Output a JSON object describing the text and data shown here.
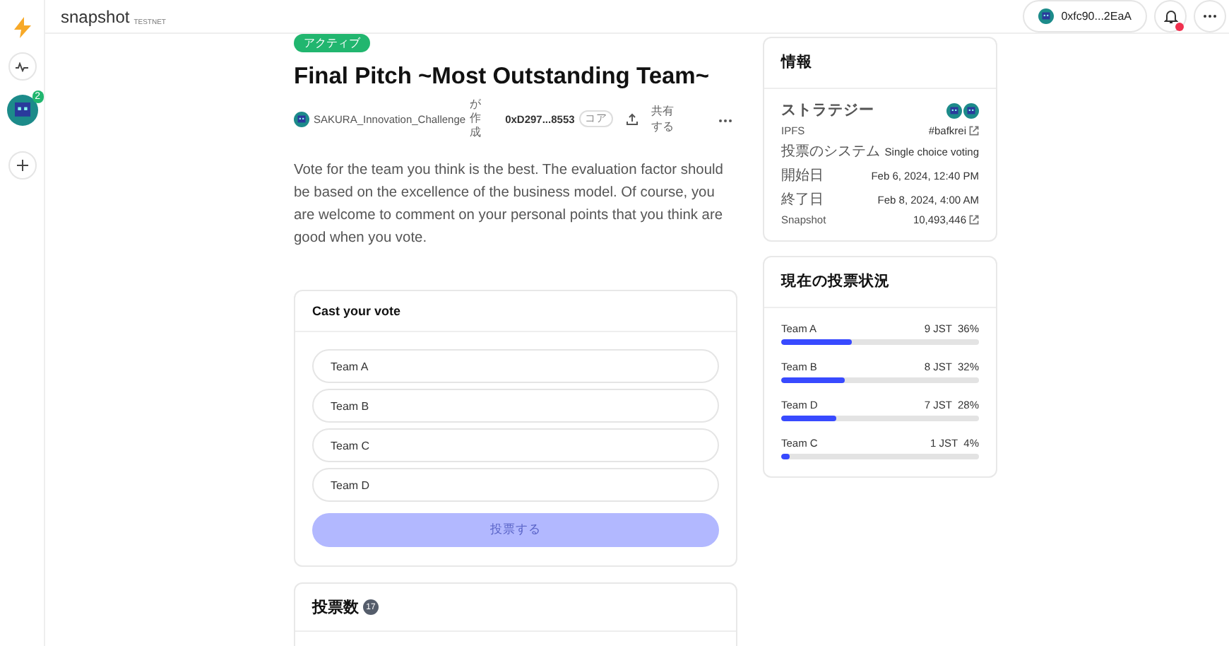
{
  "brand": {
    "name": "snapshot",
    "tag": "TESTNET"
  },
  "sidebar": {
    "space_badge": "2"
  },
  "header": {
    "account": "0xfc90...2EaA",
    "has_notification": true
  },
  "proposal": {
    "status": "アクティブ",
    "title": "Final Pitch ~Most Outstanding Team~",
    "space": "SAKURA_Innovation_Challenge",
    "created_by": "が作成",
    "author": "0xD297...8553",
    "author_badge": "コア",
    "share": "共有する",
    "body": "Vote for the team you think is the best. The evaluation factor should be based on the excellence of the business model. Of course, you are welcome to comment on your personal points that you think are good when you vote."
  },
  "vote": {
    "title": "Cast your vote",
    "choices": [
      {
        "label": "Team A",
        "selected": false
      },
      {
        "label": "Team B",
        "selected": false
      },
      {
        "label": "Team C",
        "selected": false
      },
      {
        "label": "Team D",
        "selected": false
      }
    ],
    "button": "投票する",
    "disabled": true
  },
  "votes": {
    "title": "投票数",
    "count": "17"
  },
  "info": {
    "title": "情報",
    "strategy": "ストラテジー",
    "rows": [
      {
        "label": "IPFS",
        "value": "#bafkrei",
        "link": true,
        "kind": "small"
      },
      {
        "label": "投票のシステム",
        "value": "Single choice voting",
        "link": false,
        "kind": "large"
      },
      {
        "label": "開始日",
        "value": "Feb 6, 2024, 12:40 PM",
        "link": false,
        "kind": "large"
      },
      {
        "label": "終了日",
        "value": "Feb 8, 2024, 4:00 AM",
        "link": false,
        "kind": "large"
      },
      {
        "label": "Snapshot",
        "value": "10,493,446",
        "link": true,
        "kind": "small"
      }
    ]
  },
  "results": {
    "title": "現在の投票状況",
    "rows": [
      {
        "label": "Team A",
        "amount": "9 JST",
        "percent": "36%",
        "level": 0.36
      },
      {
        "label": "Team B",
        "amount": "8 JST",
        "percent": "32%",
        "level": 0.32
      },
      {
        "label": "Team D",
        "amount": "7 JST",
        "percent": "28%",
        "level": 0.28
      },
      {
        "label": "Team C",
        "amount": "1 JST",
        "percent": "4%",
        "level": 0.04
      }
    ]
  }
}
